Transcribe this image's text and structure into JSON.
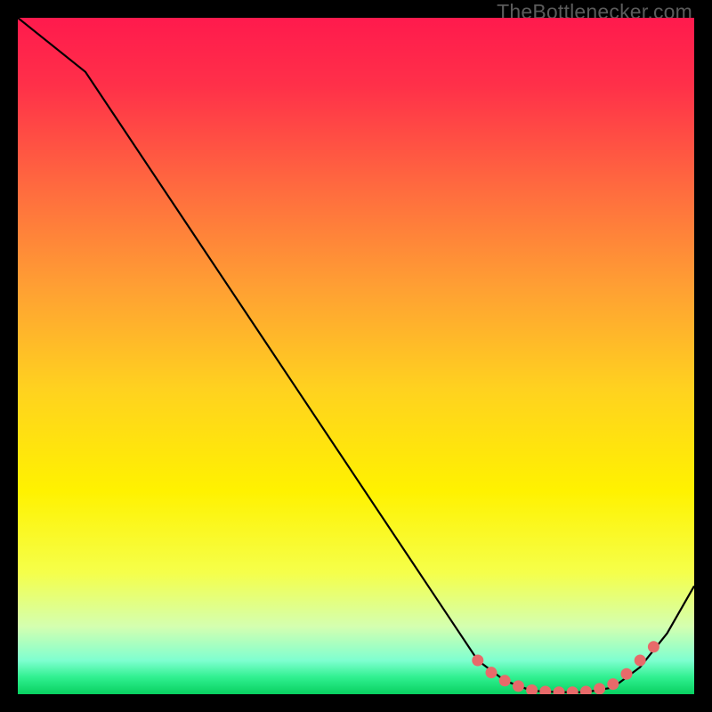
{
  "watermark": "TheBottlenecker.com",
  "chart_data": {
    "type": "line",
    "title": "",
    "xlabel": "",
    "ylabel": "",
    "xlim": [
      0,
      100
    ],
    "ylim": [
      0,
      100
    ],
    "grid": false,
    "series": [
      {
        "name": "curve",
        "x": [
          0,
          10,
          20,
          30,
          40,
          50,
          60,
          68,
          72,
          76,
          80,
          84,
          88,
          92,
          96,
          100
        ],
        "y": [
          100,
          92,
          77,
          62,
          47,
          32,
          17,
          5,
          2,
          0.5,
          0.3,
          0.3,
          1,
          4,
          9,
          16
        ]
      }
    ],
    "markers": {
      "name": "optimal-range",
      "x": [
        68,
        70,
        72,
        74,
        76,
        78,
        80,
        82,
        84,
        86,
        88,
        90,
        92,
        94
      ],
      "y": [
        5,
        3.2,
        2,
        1.2,
        0.6,
        0.4,
        0.3,
        0.3,
        0.4,
        0.8,
        1.5,
        3,
        5,
        7
      ]
    },
    "gradient_stops": [
      {
        "offset": 0.0,
        "color": "#ff1a4d"
      },
      {
        "offset": 0.1,
        "color": "#ff3049"
      },
      {
        "offset": 0.25,
        "color": "#ff6a3f"
      },
      {
        "offset": 0.4,
        "color": "#ffa033"
      },
      {
        "offset": 0.55,
        "color": "#ffd21f"
      },
      {
        "offset": 0.7,
        "color": "#fff200"
      },
      {
        "offset": 0.82,
        "color": "#f5ff4a"
      },
      {
        "offset": 0.9,
        "color": "#d4ffb0"
      },
      {
        "offset": 0.95,
        "color": "#7fffd0"
      },
      {
        "offset": 0.975,
        "color": "#30f090"
      },
      {
        "offset": 1.0,
        "color": "#08d060"
      }
    ],
    "marker_color": "#e86a6a",
    "line_color": "#000000"
  }
}
